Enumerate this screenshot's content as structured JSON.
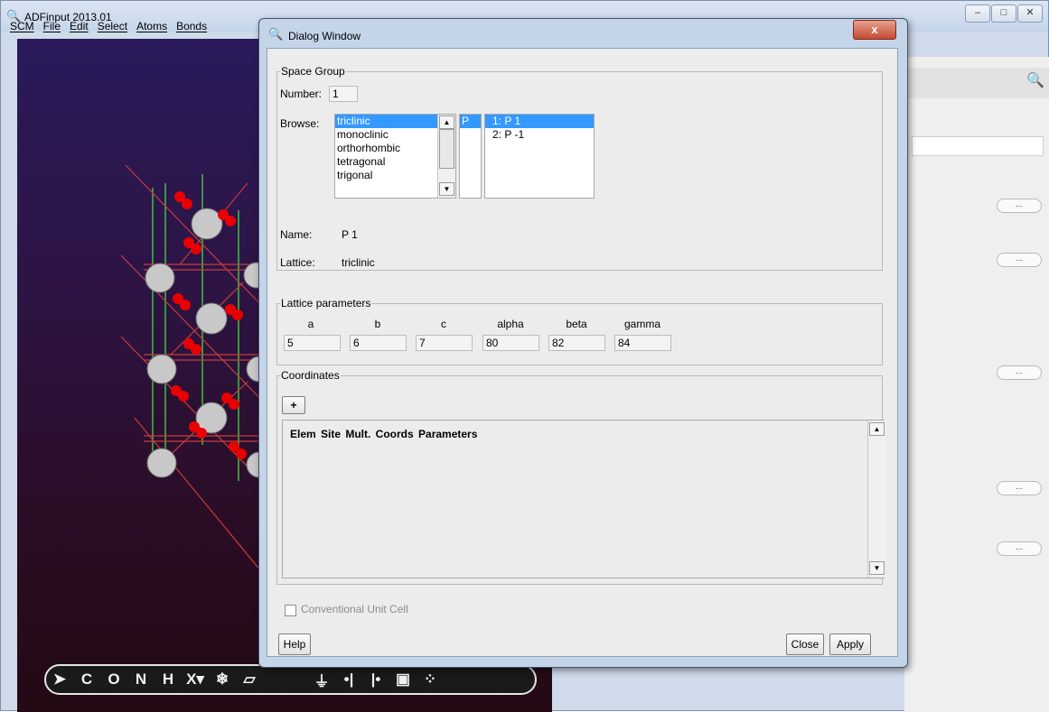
{
  "main_window": {
    "title": "ADFinput 2013.01",
    "menus": [
      "SCM",
      "File",
      "Edit",
      "Select",
      "Atoms",
      "Bonds"
    ],
    "window_buttons": [
      "–",
      "□",
      "✕"
    ],
    "toolbar": [
      "C",
      "O",
      "N",
      "H",
      "X▾"
    ],
    "right_panel_dots": [
      "...",
      "...",
      "...",
      "...",
      "..."
    ]
  },
  "dialog": {
    "title": "Dialog Window",
    "close_glyph": "x",
    "space_group": {
      "legend": "Space Group",
      "number_label": "Number:",
      "number_value": "1",
      "browse_label": "Browse:",
      "systems": [
        "triclinic",
        "monoclinic",
        "orthorhombic",
        "tetragonal",
        "trigonal"
      ],
      "selected_system": "triclinic",
      "lattice_letters": [
        "P"
      ],
      "groups": [
        "1: P 1",
        "2: P -1"
      ],
      "selected_group": "1: P 1",
      "name_label": "Name:",
      "name_value": "P 1",
      "lattice_label": "Lattice:",
      "lattice_value": "triclinic"
    },
    "lattice_parameters": {
      "legend": "Lattice parameters",
      "headers": [
        "a",
        "b",
        "c",
        "alpha",
        "beta",
        "gamma"
      ],
      "values": [
        "5",
        "6",
        "7",
        "80",
        "82",
        "84"
      ]
    },
    "coordinates": {
      "legend": "Coordinates",
      "add_label": "+",
      "table_header": "Elem  Site  Mult.  Coords  Parameters"
    },
    "conventional_label": "Conventional Unit Cell",
    "help_label": "Help",
    "close_label": "Close",
    "apply_label": "Apply"
  }
}
